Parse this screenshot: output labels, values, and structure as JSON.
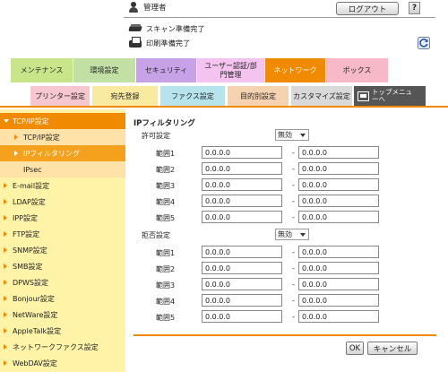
{
  "header": {
    "user_label": "管理者",
    "logout_label": "ログアウト",
    "help_label": "?",
    "scan_status": "スキャン準備完了",
    "print_status": "印刷準備完了"
  },
  "main_tabs": [
    {
      "label": "メンテナンス",
      "color": "#c8e58a"
    },
    {
      "label": "環境設定",
      "color": "#c3e0a4"
    },
    {
      "label": "セキュリティ",
      "color": "#c8a2e6"
    },
    {
      "label": "ユーザー認証/部門管理",
      "color": "#f5c3f0"
    },
    {
      "label": "ネットワーク",
      "color": "#f08a00"
    },
    {
      "label": "ボックス",
      "color": "#f7b8c8"
    }
  ],
  "sub_tabs": [
    {
      "label": "プリンター設定",
      "color": "#f7c7cf"
    },
    {
      "label": "宛先登録",
      "color": "#f8eba0"
    },
    {
      "label": "ファクス設定",
      "color": "#b7e3ec"
    },
    {
      "label": "目的別設定",
      "color": "#f6d3b0"
    },
    {
      "label": "カスタマイズ設定",
      "color": "#d9d9d9"
    },
    {
      "label": "トップメニューへ",
      "color": "#555555"
    }
  ],
  "sidebar": {
    "items": [
      {
        "label": "TCP/IP設定",
        "kind": "top"
      },
      {
        "label": "TCP/IP設定",
        "kind": "sub"
      },
      {
        "label": "IPフィルタリング",
        "kind": "sel"
      },
      {
        "label": "IPsec",
        "kind": "sub"
      },
      {
        "label": "E-mail設定",
        "kind": "item"
      },
      {
        "label": "LDAP設定",
        "kind": "item"
      },
      {
        "label": "IPP設定",
        "kind": "item"
      },
      {
        "label": "FTP設定",
        "kind": "item"
      },
      {
        "label": "SNMP設定",
        "kind": "item"
      },
      {
        "label": "SMB設定",
        "kind": "item"
      },
      {
        "label": "DPWS設定",
        "kind": "item"
      },
      {
        "label": "Bonjour設定",
        "kind": "item"
      },
      {
        "label": "NetWare設定",
        "kind": "item"
      },
      {
        "label": "AppleTalk設定",
        "kind": "item"
      },
      {
        "label": "ネットワークファクス設定",
        "kind": "item"
      },
      {
        "label": "WebDAV設定",
        "kind": "item"
      }
    ]
  },
  "content": {
    "title": "IPフィルタリング",
    "allow": {
      "label": "許可設定",
      "select_value": "無効",
      "ranges": [
        {
          "label": "範囲1",
          "from": "0.0.0.0",
          "to": "0.0.0.0"
        },
        {
          "label": "範囲2",
          "from": "0.0.0.0",
          "to": "0.0.0.0"
        },
        {
          "label": "範囲3",
          "from": "0.0.0.0",
          "to": "0.0.0.0"
        },
        {
          "label": "範囲4",
          "from": "0.0.0.0",
          "to": "0.0.0.0"
        },
        {
          "label": "範囲5",
          "from": "0.0.0.0",
          "to": "0.0.0.0"
        }
      ]
    },
    "deny": {
      "label": "拒否設定",
      "select_value": "無効",
      "ranges": [
        {
          "label": "範囲1",
          "from": "0.0.0.0",
          "to": "0.0.0.0"
        },
        {
          "label": "範囲2",
          "from": "0.0.0.0",
          "to": "0.0.0.0"
        },
        {
          "label": "範囲3",
          "from": "0.0.0.0",
          "to": "0.0.0.0"
        },
        {
          "label": "範囲4",
          "from": "0.0.0.0",
          "to": "0.0.0.0"
        },
        {
          "label": "範囲5",
          "from": "0.0.0.0",
          "to": "0.0.0.0"
        }
      ]
    },
    "dash": "-",
    "ok_label": "OK",
    "cancel_label": "キャンセル"
  }
}
